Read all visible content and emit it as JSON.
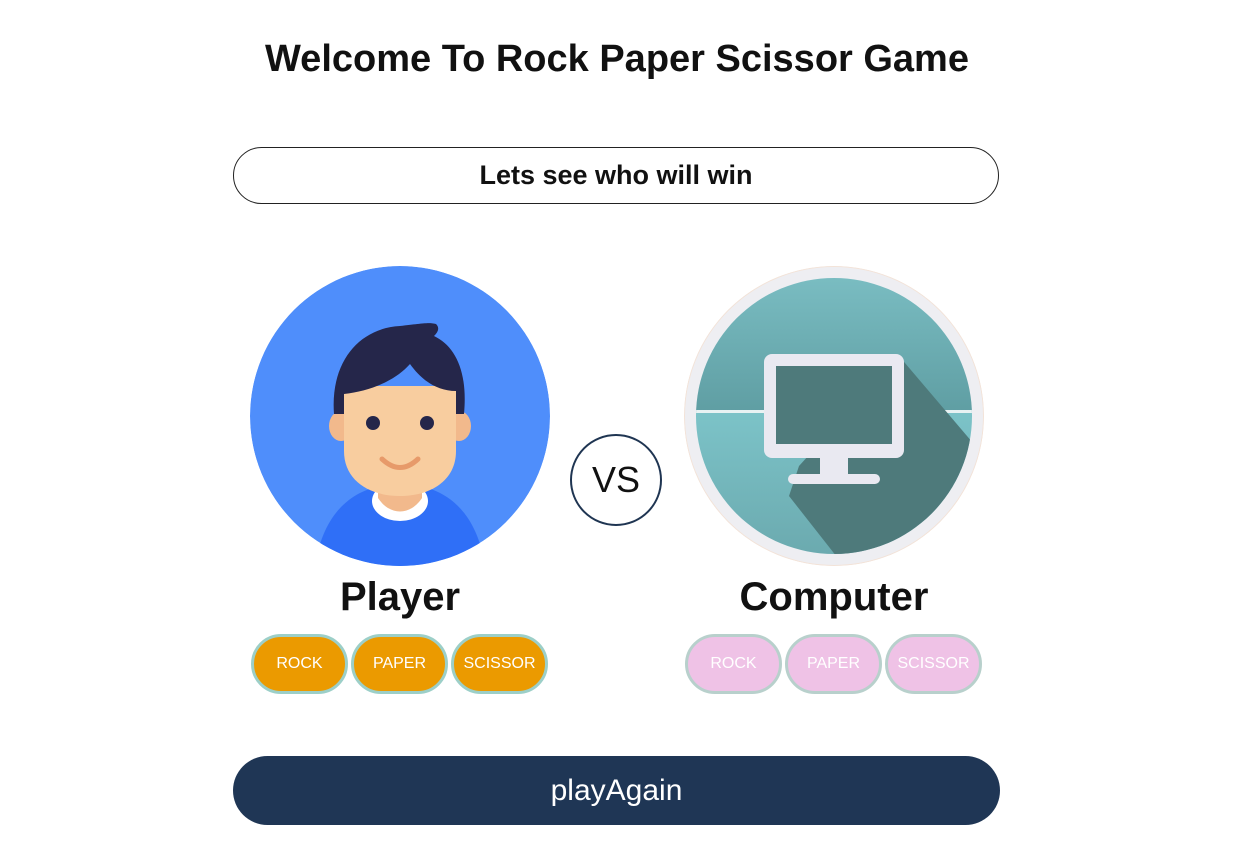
{
  "header": {
    "title": "Welcome To Rock Paper Scissor Game"
  },
  "status": {
    "message": "Lets see who will win"
  },
  "versus": {
    "label": "VS"
  },
  "player": {
    "name": "Player",
    "avatar_icon": "user-avatar-icon",
    "choices": [
      "ROCK",
      "PAPER",
      "SCISSOR"
    ],
    "choice_color": "#eb9a00"
  },
  "computer": {
    "name": "Computer",
    "avatar_icon": "computer-monitor-icon",
    "choices": [
      "ROCK",
      "PAPER",
      "SCISSOR"
    ],
    "choice_color": "#efc2e6"
  },
  "actions": {
    "play_again_label": "playAgain",
    "button_color": "#1f3655"
  }
}
